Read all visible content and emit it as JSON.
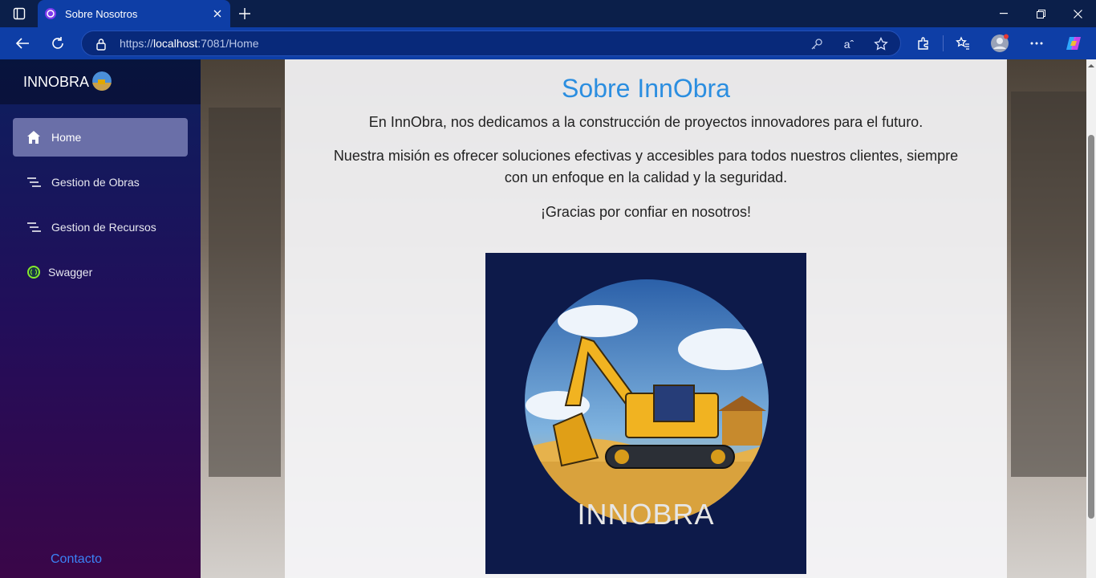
{
  "browser": {
    "tab_title": "Sobre Nosotros",
    "url_scheme": "https://",
    "url_host": "localhost",
    "url_rest": ":7081/Home"
  },
  "sidebar": {
    "brand": "INNOBRA",
    "items": [
      {
        "label": "Home",
        "icon": "home-icon"
      },
      {
        "label": "Gestion de Obras",
        "icon": "list-icon"
      },
      {
        "label": "Gestion de Recursos",
        "icon": "list-icon"
      },
      {
        "label": "Swagger",
        "icon": "swagger-icon"
      }
    ],
    "contact": "Contacto"
  },
  "main": {
    "title": "Sobre InnObra",
    "p1": "En InnObra, nos dedicamos a la construcción de proyectos innovadores para el futuro.",
    "p2": "Nuestra misión es ofrecer soluciones efectivas y accesibles para todos nuestros clientes, siempre con un enfoque en la calidad y la seguridad.",
    "p3": "¡Gracias por confiar en nosotros!",
    "logo_text": "INNOBRA"
  },
  "colors": {
    "chrome": "#0e3ea6",
    "title": "#2b8ee0",
    "contact": "#3b82f6"
  }
}
